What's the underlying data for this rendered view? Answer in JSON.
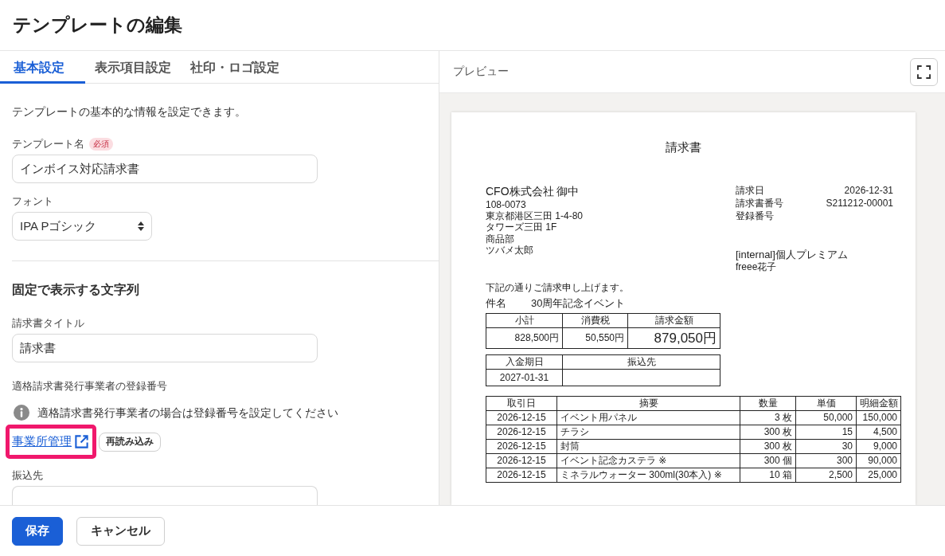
{
  "page": {
    "title": "テンプレートの編集"
  },
  "tabs": [
    {
      "label": "基本設定",
      "selected": true
    },
    {
      "label": "表示項目設定",
      "selected": false
    },
    {
      "label": "社印・ロゴ設定",
      "selected": false
    }
  ],
  "settings": {
    "description": "テンプレートの基本的な情報を設定できます。",
    "template_name": {
      "label": "テンプレート名",
      "required_badge": "必須",
      "value": "インボイス対応請求書"
    },
    "font": {
      "label": "フォント",
      "value": "IPA Pゴシック"
    },
    "fixed_strings": {
      "heading": "固定で表示する文字列",
      "invoice_title": {
        "label": "請求書タイトル",
        "value": "請求書"
      },
      "registration_number": {
        "label": "適格請求書発行事業者の登録番号",
        "notice": "適格請求書発行事業者の場合は登録番号を設定してください",
        "link": {
          "label": "事業所管理",
          "highlighted": true
        },
        "reload_button": "再読み込み"
      },
      "bank_account": {
        "label": "振込先"
      }
    }
  },
  "preview": {
    "title": "プレビュー",
    "document": {
      "title": "請求書",
      "recipient": {
        "name": "CFO株式会社 御中",
        "address": [
          "108-0073",
          "東京都港区三田 1-4-80",
          "タワーズ三田 1F"
        ],
        "contact": [
          "商品部",
          "ツバメ太郎"
        ]
      },
      "meta": [
        {
          "label": "請求日",
          "value": "2026-12-31"
        },
        {
          "label": "請求書番号",
          "value": "S211212-00001"
        },
        {
          "label": "登録番号"
        }
      ],
      "issuer": {
        "name": "[internal]個人プレミアム",
        "person": "freee花子"
      },
      "greeting": "下記の通りご請求申し上げます。",
      "subject": {
        "label": "件名",
        "value": "30周年記念イベント"
      },
      "totals": {
        "columns": [
          "小計",
          "消費税",
          "請求金額"
        ],
        "values": [
          "828,500円",
          "50,550円",
          "879,050円"
        ]
      },
      "payment": {
        "columns": [
          "入金期日",
          "振込先"
        ],
        "values": [
          "2027-01-31"
        ]
      },
      "items": {
        "columns": [
          "取引日",
          "摘要",
          "数量",
          "単価",
          "明細金額"
        ],
        "rows": [
          [
            "2026-12-15",
            "イベント用パネル",
            "3 枚",
            "50,000",
            "150,000"
          ],
          [
            "2026-12-15",
            "チラシ",
            "300 枚",
            "15",
            "4,500"
          ],
          [
            "2026-12-15",
            "封筒",
            "300 枚",
            "30",
            "9,000"
          ],
          [
            "2026-12-15",
            "イベント記念カステラ ※",
            "300 個",
            "300",
            "90,000"
          ],
          [
            "2026-12-15",
            "ミネラルウォーター 300ml(30本入) ※",
            "10 箱",
            "2,500",
            "25,000"
          ]
        ]
      }
    }
  },
  "footer": {
    "buttons": [
      {
        "label": "保存",
        "kind": "primary"
      },
      {
        "label": "キャンセル",
        "kind": "secondary"
      }
    ]
  }
}
